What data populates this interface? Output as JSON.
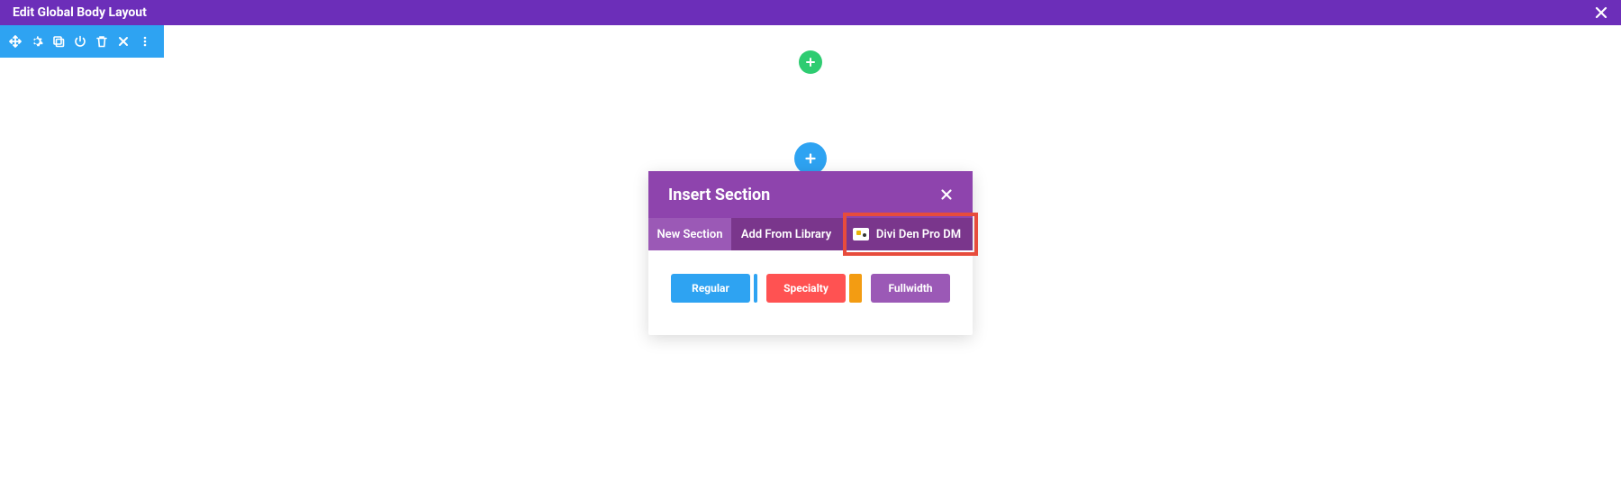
{
  "header": {
    "title": "Edit Global Body Layout"
  },
  "modal": {
    "title": "Insert Section",
    "tabs": {
      "new_section": "New Section",
      "add_from_library": "Add From Library",
      "divi_den": "Divi Den Pro DM"
    },
    "buttons": {
      "regular": "Regular",
      "specialty": "Specialty",
      "fullwidth": "Fullwidth"
    }
  }
}
